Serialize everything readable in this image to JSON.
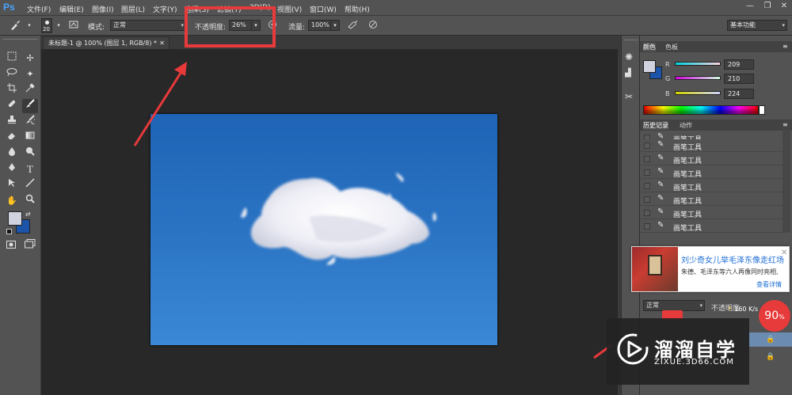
{
  "app": {
    "logo": "Ps"
  },
  "menu": [
    "文件(F)",
    "编辑(E)",
    "图像(I)",
    "图层(L)",
    "文字(Y)",
    "选择(S)",
    "滤镜(T)",
    "3D(D)",
    "视图(V)",
    "窗口(W)",
    "帮助(H)"
  ],
  "window_controls": {
    "minimize": "—",
    "restore": "❐",
    "close": "✕"
  },
  "options": {
    "brush_size": "20",
    "mode_label": "模式:",
    "mode_value": "正常",
    "opacity_label": "不透明度:",
    "opacity_value": "26%",
    "flow_label": "流量:",
    "flow_value": "100%",
    "workspace": "基本功能"
  },
  "document": {
    "tab_title": "未标题-1 @ 100% (图层 1, RGB/8) *",
    "close": "✕"
  },
  "color_panel": {
    "tabs": [
      "颜色",
      "色板"
    ],
    "r_label": "R",
    "g_label": "G",
    "b_label": "B",
    "r": "209",
    "g": "210",
    "b": "224",
    "foreground": "#d1d2e0",
    "background": "#1b54a8"
  },
  "history_panel": {
    "tabs": [
      "历史记录",
      "动作"
    ],
    "items": [
      "画笔工具",
      "画笔工具",
      "画笔工具",
      "画笔工具",
      "画笔工具",
      "画笔工具",
      "画笔工具",
      "画笔工具"
    ]
  },
  "layers_panel": {
    "blend_mode": "正常",
    "opacity_label": "不透明度"
  },
  "ad": {
    "title": "刘少奇女儿举毛泽东像走红场",
    "subtitle": "朱德、毛泽东等六人再像同时亮相,",
    "link": "查看详情",
    "close": "✕"
  },
  "watermark": {
    "title": "溜溜自学",
    "url": "ZIXUE.3D66.COM"
  },
  "network": {
    "speed": "160 K/s",
    "percent": "90",
    "percent_unit": "%"
  },
  "colors": {
    "highlight": "#e8393b",
    "canvas_top": "#1f64b6",
    "canvas_bottom": "#3b89d6"
  },
  "icons": [
    "brush-icon",
    "marquee-icon",
    "move-icon",
    "lasso-icon",
    "magic-wand-icon",
    "crop-icon",
    "eyedropper-icon",
    "healing-icon",
    "brush-tool-icon",
    "stamp-icon",
    "history-brush-icon",
    "eraser-icon",
    "gradient-icon",
    "blur-icon",
    "dodge-icon",
    "pen-icon",
    "type-icon",
    "path-select-icon",
    "line-icon",
    "hand-icon",
    "zoom-icon",
    "quick-mask-icon",
    "screen-mode-icon",
    "lock-icon"
  ]
}
